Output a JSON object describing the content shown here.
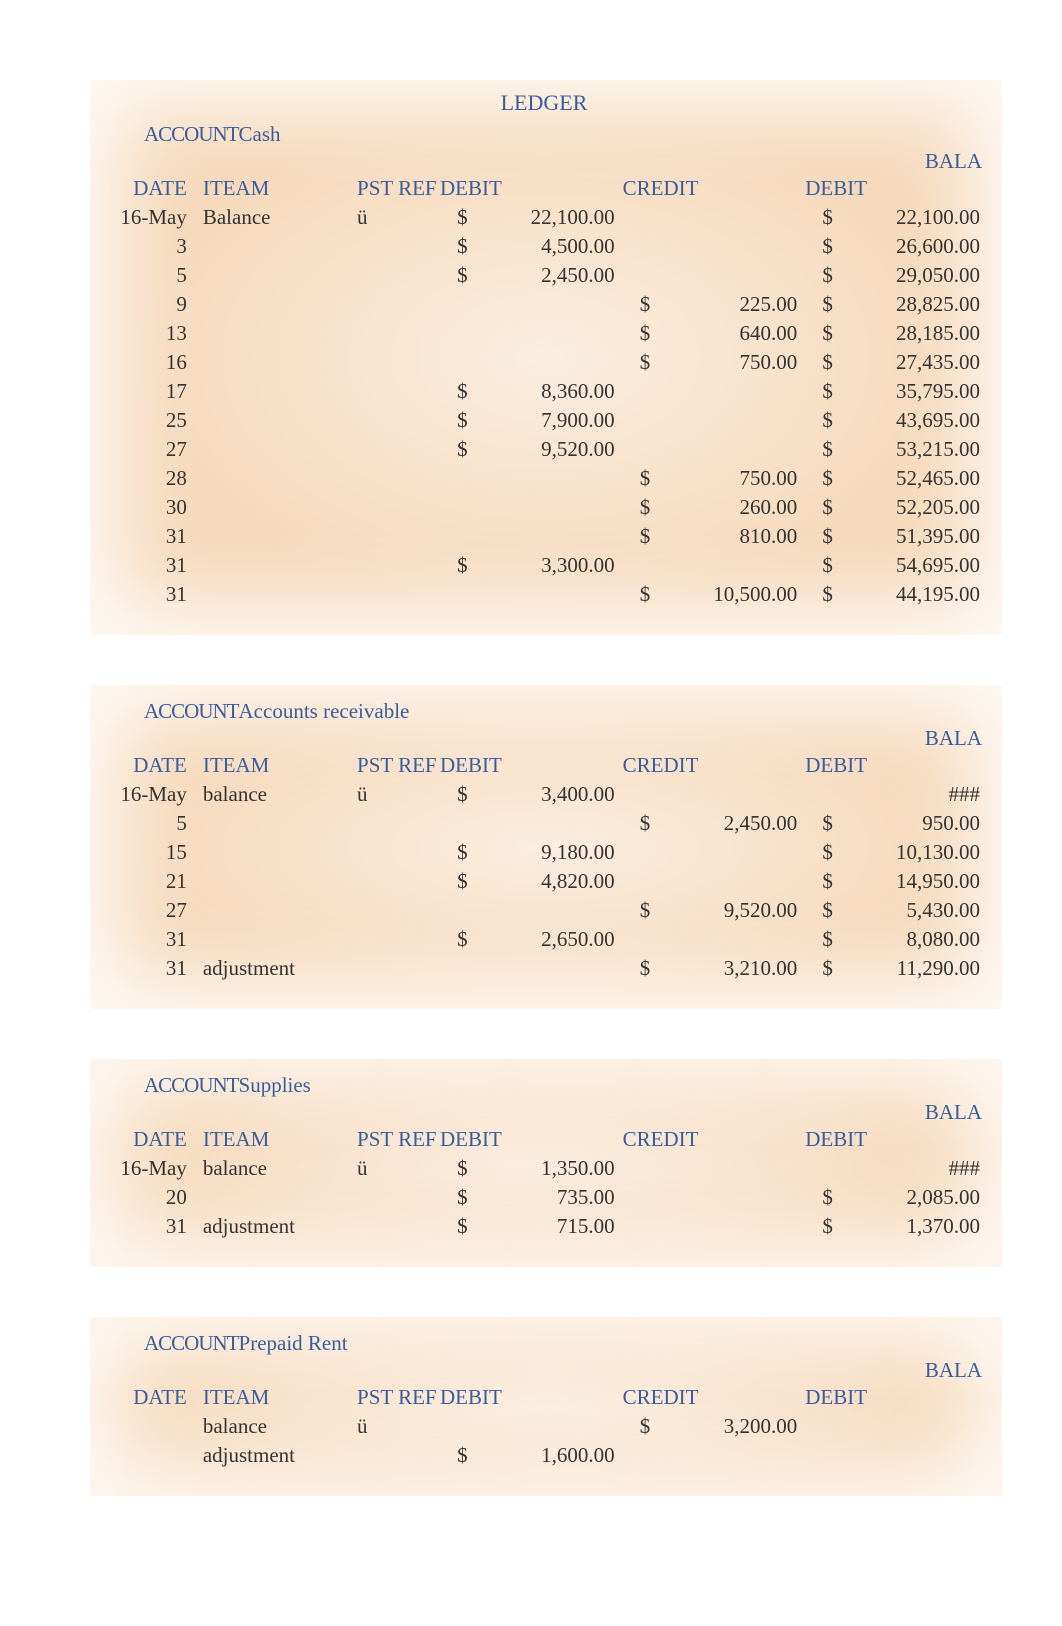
{
  "title": "LEDGER",
  "labels": {
    "account": "ACCOUNT",
    "balance_abbrev": "BALA",
    "date": "DATE",
    "item": "ITEAM",
    "pst_ref": "PST REF",
    "debit_hdr": "DEBIT",
    "credit_hdr": "CREDIT",
    "bal_debit_hdr": "DEBIT",
    "checkmark": "ü",
    "dollar": "$",
    "hash": "###"
  },
  "accounts": [
    {
      "name": "Cash",
      "show_title": true,
      "rows": [
        {
          "date": "16-May",
          "item": "Balance",
          "pstref": "ü",
          "d_cur": "$",
          "d_amt": "22,100.00",
          "c_cur": "",
          "c_amt": "",
          "b_cur": "$",
          "b_amt": "22,100.00"
        },
        {
          "date": "3",
          "item": "",
          "pstref": "",
          "d_cur": "$",
          "d_amt": "4,500.00",
          "c_cur": "",
          "c_amt": "",
          "b_cur": "$",
          "b_amt": "26,600.00"
        },
        {
          "date": "5",
          "item": "",
          "pstref": "",
          "d_cur": "$",
          "d_amt": "2,450.00",
          "c_cur": "",
          "c_amt": "",
          "b_cur": "$",
          "b_amt": "29,050.00"
        },
        {
          "date": "9",
          "item": "",
          "pstref": "",
          "d_cur": "",
          "d_amt": "",
          "c_cur": "$",
          "c_amt": "225.00",
          "b_cur": "$",
          "b_amt": "28,825.00"
        },
        {
          "date": "13",
          "item": "",
          "pstref": "",
          "d_cur": "",
          "d_amt": "",
          "c_cur": "$",
          "c_amt": "640.00",
          "b_cur": "$",
          "b_amt": "28,185.00"
        },
        {
          "date": "16",
          "item": "",
          "pstref": "",
          "d_cur": "",
          "d_amt": "",
          "c_cur": "$",
          "c_amt": "750.00",
          "b_cur": "$",
          "b_amt": "27,435.00"
        },
        {
          "date": "17",
          "item": "",
          "pstref": "",
          "d_cur": "$",
          "d_amt": "8,360.00",
          "c_cur": "",
          "c_amt": "",
          "b_cur": "$",
          "b_amt": "35,795.00"
        },
        {
          "date": "25",
          "item": "",
          "pstref": "",
          "d_cur": "$",
          "d_amt": "7,900.00",
          "c_cur": "",
          "c_amt": "",
          "b_cur": "$",
          "b_amt": "43,695.00"
        },
        {
          "date": "27",
          "item": "",
          "pstref": "",
          "d_cur": "$",
          "d_amt": "9,520.00",
          "c_cur": "",
          "c_amt": "",
          "b_cur": "$",
          "b_amt": "53,215.00"
        },
        {
          "date": "28",
          "item": "",
          "pstref": "",
          "d_cur": "",
          "d_amt": "",
          "c_cur": "$",
          "c_amt": "750.00",
          "b_cur": "$",
          "b_amt": "52,465.00"
        },
        {
          "date": "30",
          "item": "",
          "pstref": "",
          "d_cur": "",
          "d_amt": "",
          "c_cur": "$",
          "c_amt": "260.00",
          "b_cur": "$",
          "b_amt": "52,205.00"
        },
        {
          "date": "31",
          "item": "",
          "pstref": "",
          "d_cur": "",
          "d_amt": "",
          "c_cur": "$",
          "c_amt": "810.00",
          "b_cur": "$",
          "b_amt": "51,395.00"
        },
        {
          "date": "31",
          "item": "",
          "pstref": "",
          "d_cur": "$",
          "d_amt": "3,300.00",
          "c_cur": "",
          "c_amt": "",
          "b_cur": "$",
          "b_amt": "54,695.00"
        },
        {
          "date": "31",
          "item": "",
          "pstref": "",
          "d_cur": "",
          "d_amt": "",
          "c_cur": "$",
          "c_amt": "10,500.00",
          "b_cur": "$",
          "b_amt": "44,195.00"
        }
      ]
    },
    {
      "name": "Accounts receivable",
      "show_title": false,
      "rows": [
        {
          "date": "16-May",
          "item": "balance",
          "pstref": "ü",
          "d_cur": "$",
          "d_amt": "3,400.00",
          "c_cur": "",
          "c_amt": "",
          "b_cur": "",
          "b_amt": "###"
        },
        {
          "date": "5",
          "item": "",
          "pstref": "",
          "d_cur": "",
          "d_amt": "",
          "c_cur": "$",
          "c_amt": "2,450.00",
          "b_cur": "$",
          "b_amt": "950.00"
        },
        {
          "date": "15",
          "item": "",
          "pstref": "",
          "d_cur": "$",
          "d_amt": "9,180.00",
          "c_cur": "",
          "c_amt": "",
          "b_cur": "$",
          "b_amt": "10,130.00"
        },
        {
          "date": "21",
          "item": "",
          "pstref": "",
          "d_cur": "$",
          "d_amt": "4,820.00",
          "c_cur": "",
          "c_amt": "",
          "b_cur": "$",
          "b_amt": "14,950.00"
        },
        {
          "date": "27",
          "item": "",
          "pstref": "",
          "d_cur": "",
          "d_amt": "",
          "c_cur": "$",
          "c_amt": "9,520.00",
          "b_cur": "$",
          "b_amt": "5,430.00"
        },
        {
          "date": "31",
          "item": "",
          "pstref": "",
          "d_cur": "$",
          "d_amt": "2,650.00",
          "c_cur": "",
          "c_amt": "",
          "b_cur": "$",
          "b_amt": "8,080.00"
        },
        {
          "date": "31",
          "item": "adjustment",
          "pstref": "",
          "d_cur": "",
          "d_amt": "",
          "c_cur": "$",
          "c_amt": "3,210.00",
          "b_cur": "$",
          "b_amt": "11,290.00"
        }
      ]
    },
    {
      "name": "Supplies",
      "show_title": false,
      "rows": [
        {
          "date": "16-May",
          "item": "balance",
          "pstref": "ü",
          "d_cur": "$",
          "d_amt": "1,350.00",
          "c_cur": "",
          "c_amt": "",
          "b_cur": "",
          "b_amt": "###"
        },
        {
          "date": "20",
          "item": "",
          "pstref": "",
          "d_cur": "$",
          "d_amt": "735.00",
          "c_cur": "",
          "c_amt": "",
          "b_cur": "$",
          "b_amt": "2,085.00"
        },
        {
          "date": "31",
          "item": "adjustment",
          "pstref": "",
          "d_cur": "$",
          "d_amt": "715.00",
          "c_cur": "",
          "c_amt": "",
          "b_cur": "$",
          "b_amt": "1,370.00"
        }
      ]
    },
    {
      "name": "Prepaid Rent",
      "show_title": false,
      "rows": [
        {
          "date": "",
          "item": "balance",
          "pstref": "ü",
          "d_cur": "",
          "d_amt": "",
          "c_cur": "$",
          "c_amt": "3,200.00",
          "b_cur": "",
          "b_amt": ""
        },
        {
          "date": "",
          "item": "adjustment",
          "pstref": "",
          "d_cur": "$",
          "d_amt": "1,600.00",
          "c_cur": "",
          "c_amt": "",
          "b_cur": "",
          "b_amt": ""
        }
      ]
    }
  ]
}
